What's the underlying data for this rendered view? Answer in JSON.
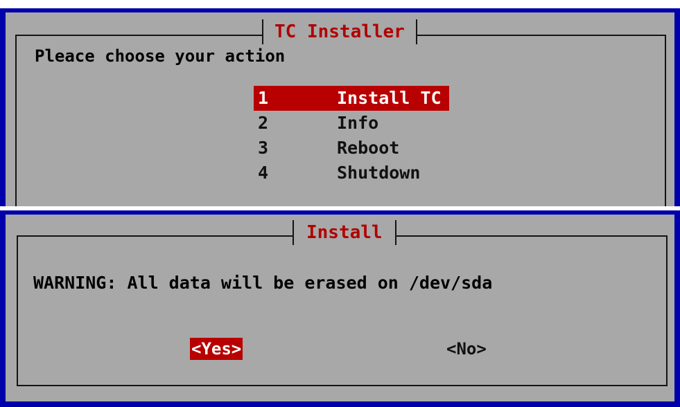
{
  "installer_dialog": {
    "title": "TC Installer",
    "prompt": "Pleace choose your action",
    "menu_items": [
      {
        "number": "1",
        "label": "Install TC",
        "selected": true
      },
      {
        "number": "2",
        "label": "Info",
        "selected": false
      },
      {
        "number": "3",
        "label": "Reboot",
        "selected": false
      },
      {
        "number": "4",
        "label": "Shutdown",
        "selected": false
      }
    ]
  },
  "install_dialog": {
    "title": "Install",
    "warning": "WARNING: All data will be erased on /dev/sda",
    "yes_label": "<Yes>",
    "no_label": "<No>"
  },
  "colors": {
    "screen_background": "#0000aa",
    "dialog_background": "#a8a8a8",
    "highlight": "#b80000",
    "title_text": "#b00000"
  }
}
